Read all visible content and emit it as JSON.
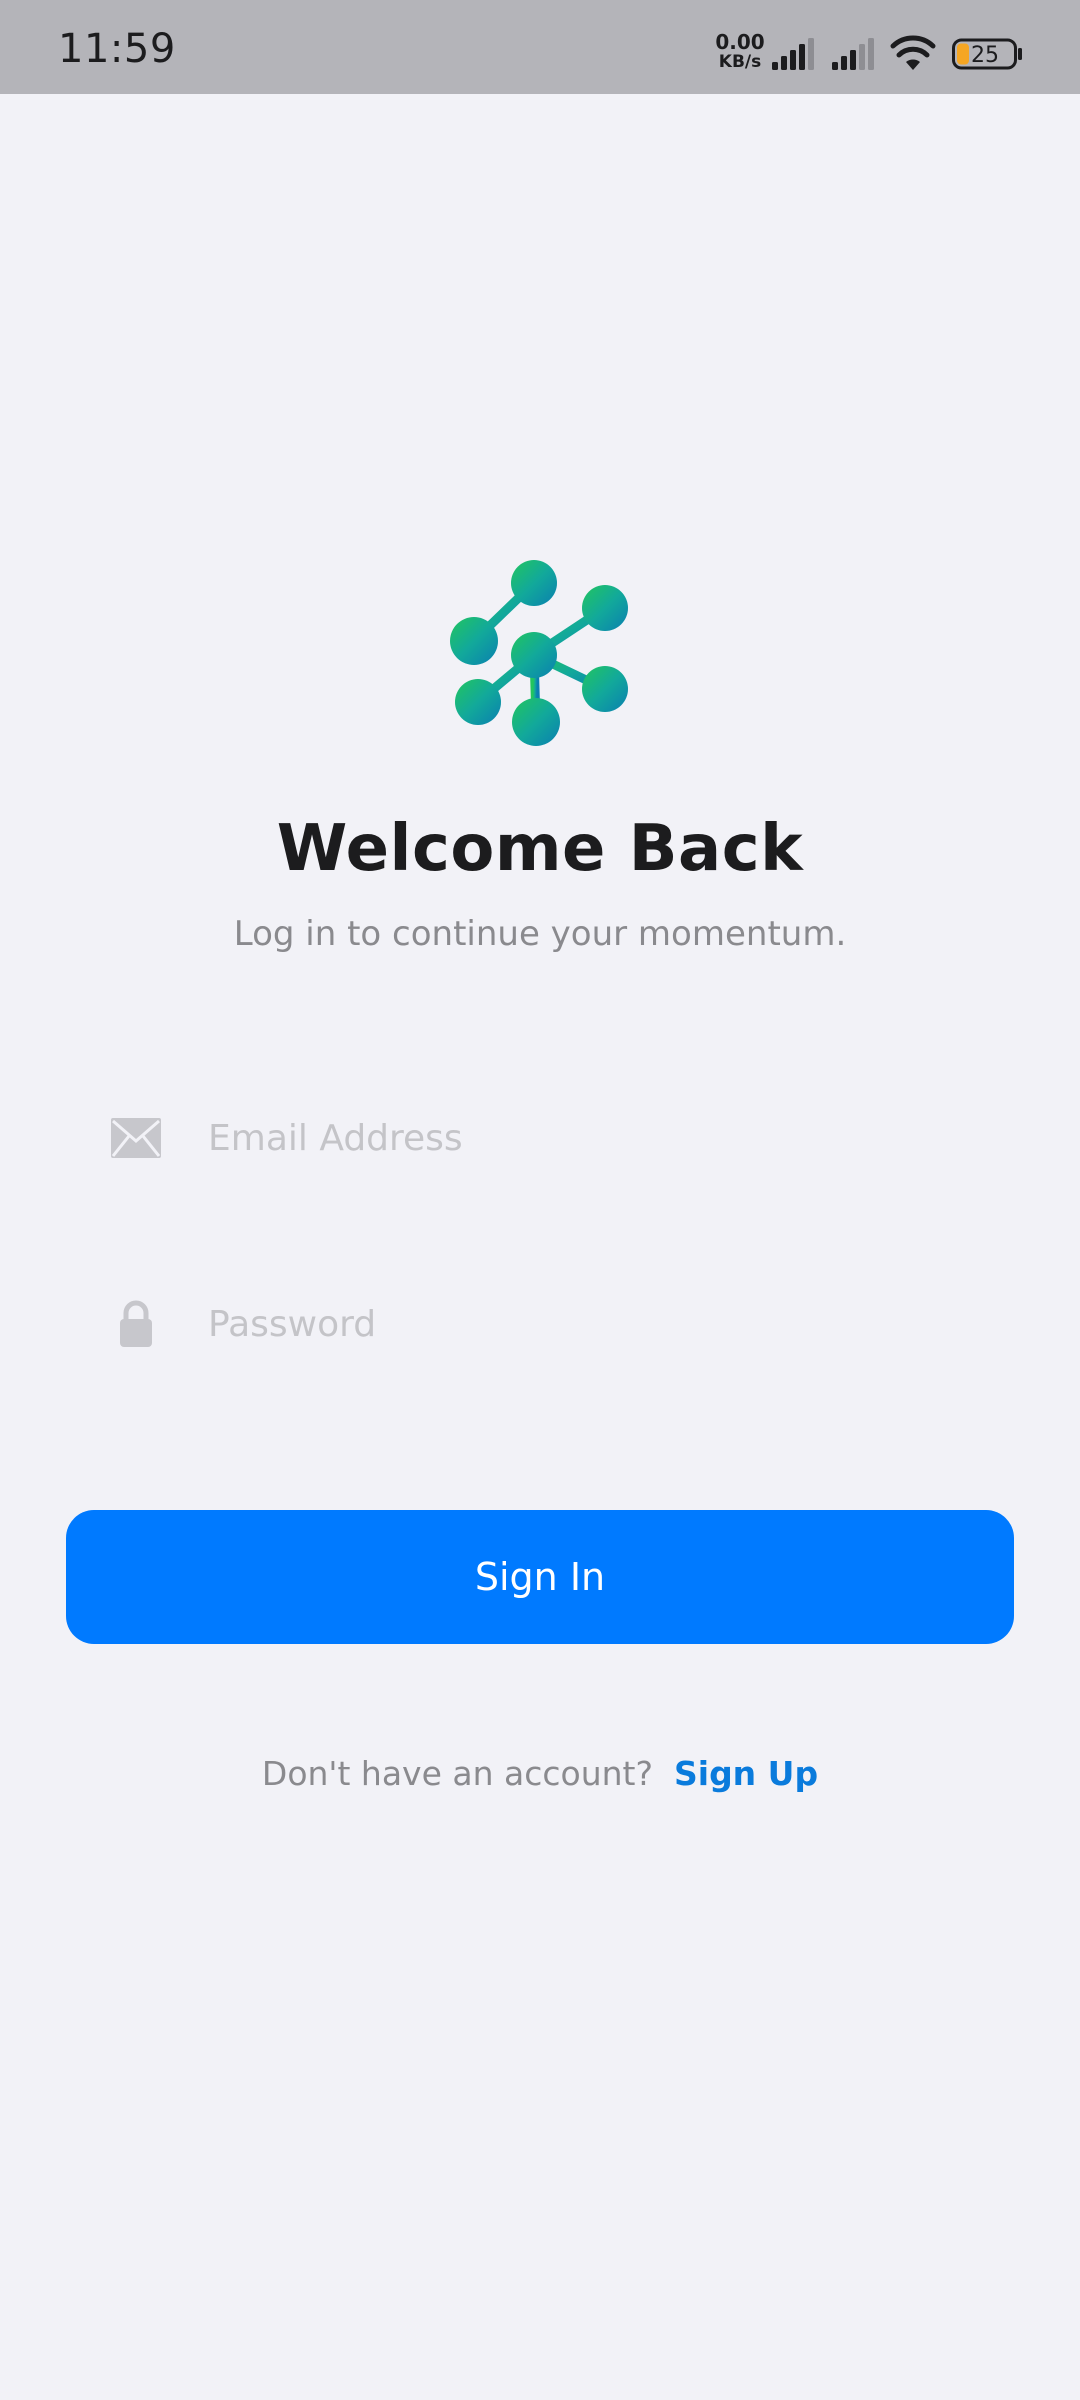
{
  "status_bar": {
    "time": "11:59",
    "net_speed_value": "0.00",
    "net_speed_unit": "KB/s",
    "battery_level": "25",
    "icons": [
      "signal-icon",
      "signal-icon",
      "wifi-icon",
      "battery-icon"
    ],
    "battery_color": "#f5a623"
  },
  "login": {
    "title": "Welcome Back",
    "subtitle": "Log in to continue your momentum.",
    "email_placeholder": "Email Address",
    "password_placeholder": "Password",
    "sign_in_label": "Sign In",
    "signup_prompt": "Don't have an account?",
    "signup_link": "Sign Up"
  },
  "colors": {
    "accent": "#007aff",
    "link": "#0a7bdc",
    "background": "#f2f2f7",
    "logo_gradient_start": "#22c55e",
    "logo_gradient_end": "#0a7fb0"
  }
}
